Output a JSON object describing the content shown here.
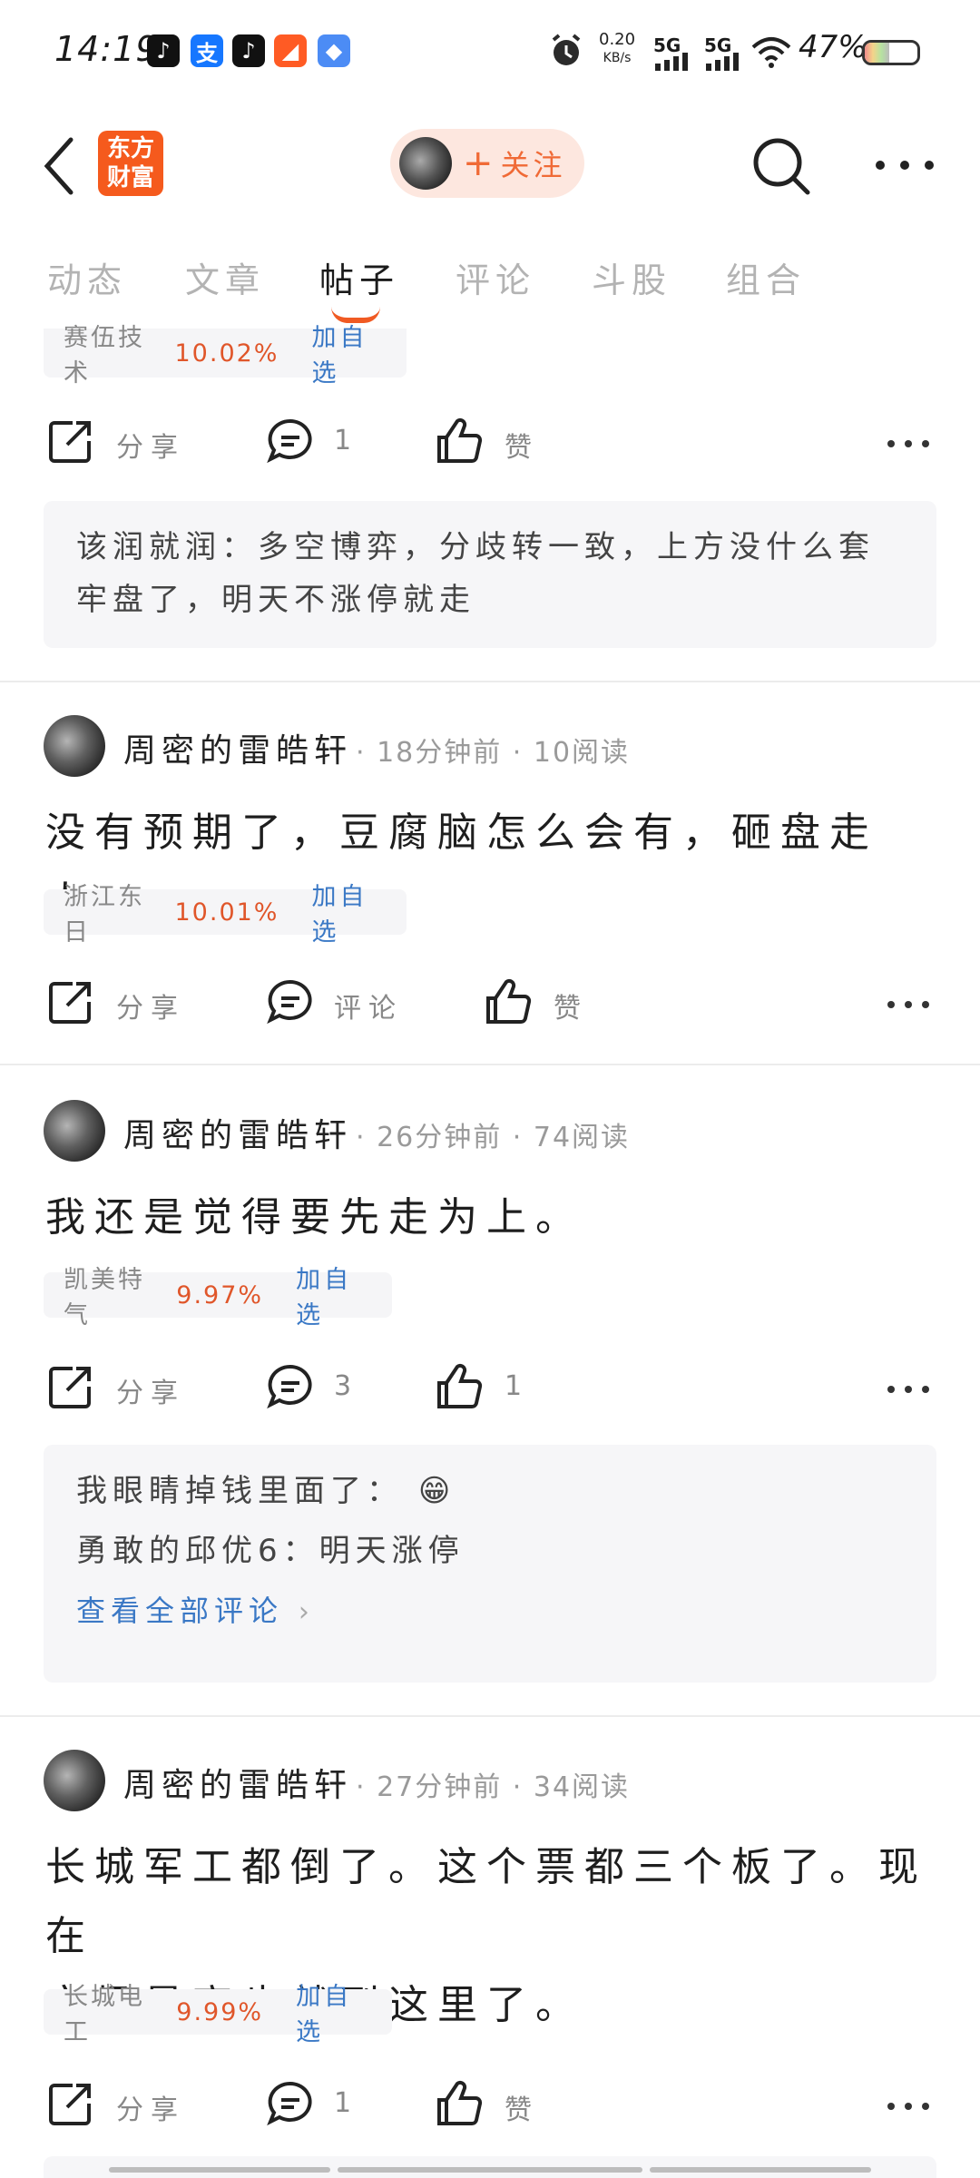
{
  "status_bar": {
    "time": "14:19",
    "apps": [
      {
        "name": "tiktok-icon",
        "glyph": "♪",
        "color": "#111111"
      },
      {
        "name": "alipay-icon",
        "glyph": "支",
        "color": "#1677ff"
      },
      {
        "name": "tiktok-icon-2",
        "glyph": "♪",
        "color": "#111111"
      },
      {
        "name": "orange-app-icon",
        "glyph": "◢",
        "color": "#ff5b24"
      },
      {
        "name": "blue-app-icon",
        "glyph": "◆",
        "color": "#4c8cf5"
      }
    ],
    "net_speed_value": "0.20",
    "net_speed_unit": "KB/s",
    "signal1": "5G",
    "signal2": "5G",
    "battery": "47%",
    "battery_level": 0.47
  },
  "header": {
    "logo_line1": "东方",
    "logo_line2": "财富",
    "follow_plus": "+",
    "follow_label": "关注"
  },
  "tabs": [
    {
      "label": "动态",
      "active": false
    },
    {
      "label": "文章",
      "active": false
    },
    {
      "label": "帖子",
      "active": true
    },
    {
      "label": "评论",
      "active": false
    },
    {
      "label": "斗股",
      "active": false
    },
    {
      "label": "组合",
      "active": false
    }
  ],
  "post0": {
    "stock": {
      "name": "赛伍技术",
      "pct": "10.02%",
      "add": "加自选"
    },
    "actions": {
      "share": "分享",
      "comments": "1",
      "like": "赞"
    },
    "comment": "该润就润：多空博弈，分歧转一致，上方没什么套牢盘了，明天不涨停就走"
  },
  "posts": [
    {
      "author": "周密的雷皓轩",
      "meta": "· 18分钟前 · 10阅读",
      "body": "没有预期了，豆腐脑怎么会有，砸盘走人。",
      "stock": {
        "name": "浙江东日",
        "pct": "10.01%",
        "add": "加自选"
      },
      "actions": {
        "share": "分享",
        "comments": "评论",
        "like": "赞"
      }
    },
    {
      "author": "周密的雷皓轩",
      "meta": "· 26分钟前 · 74阅读",
      "body": "我还是觉得要先走为上。",
      "stock": {
        "name": "凯美特气",
        "pct": "9.97%",
        "add": "加自选"
      },
      "actions": {
        "share": "分享",
        "comments": "3",
        "like": "1"
      },
      "comments_box": {
        "c1_text": "我眼睛掉钱里面了：",
        "c1_emoji": "😁",
        "c2_text": "勇敢的邱优6：明天涨停",
        "view_all": "查看全部评论"
      }
    },
    {
      "author": "周密的雷皓轩",
      "meta": "· 27分钟前 · 34阅读",
      "body_line1": "长城军工都倒了。这个票都三个板了。现在",
      "body_line2": "市场最高也就到这里了。",
      "stock": {
        "name": "长城电工",
        "pct": "9.99%",
        "add": "加自选"
      },
      "actions": {
        "share": "分享",
        "comments": "1",
        "like": "赞"
      }
    }
  ],
  "colors": {
    "accent": "#f05a23",
    "link": "#3a78c5",
    "up": "#e0562a"
  }
}
